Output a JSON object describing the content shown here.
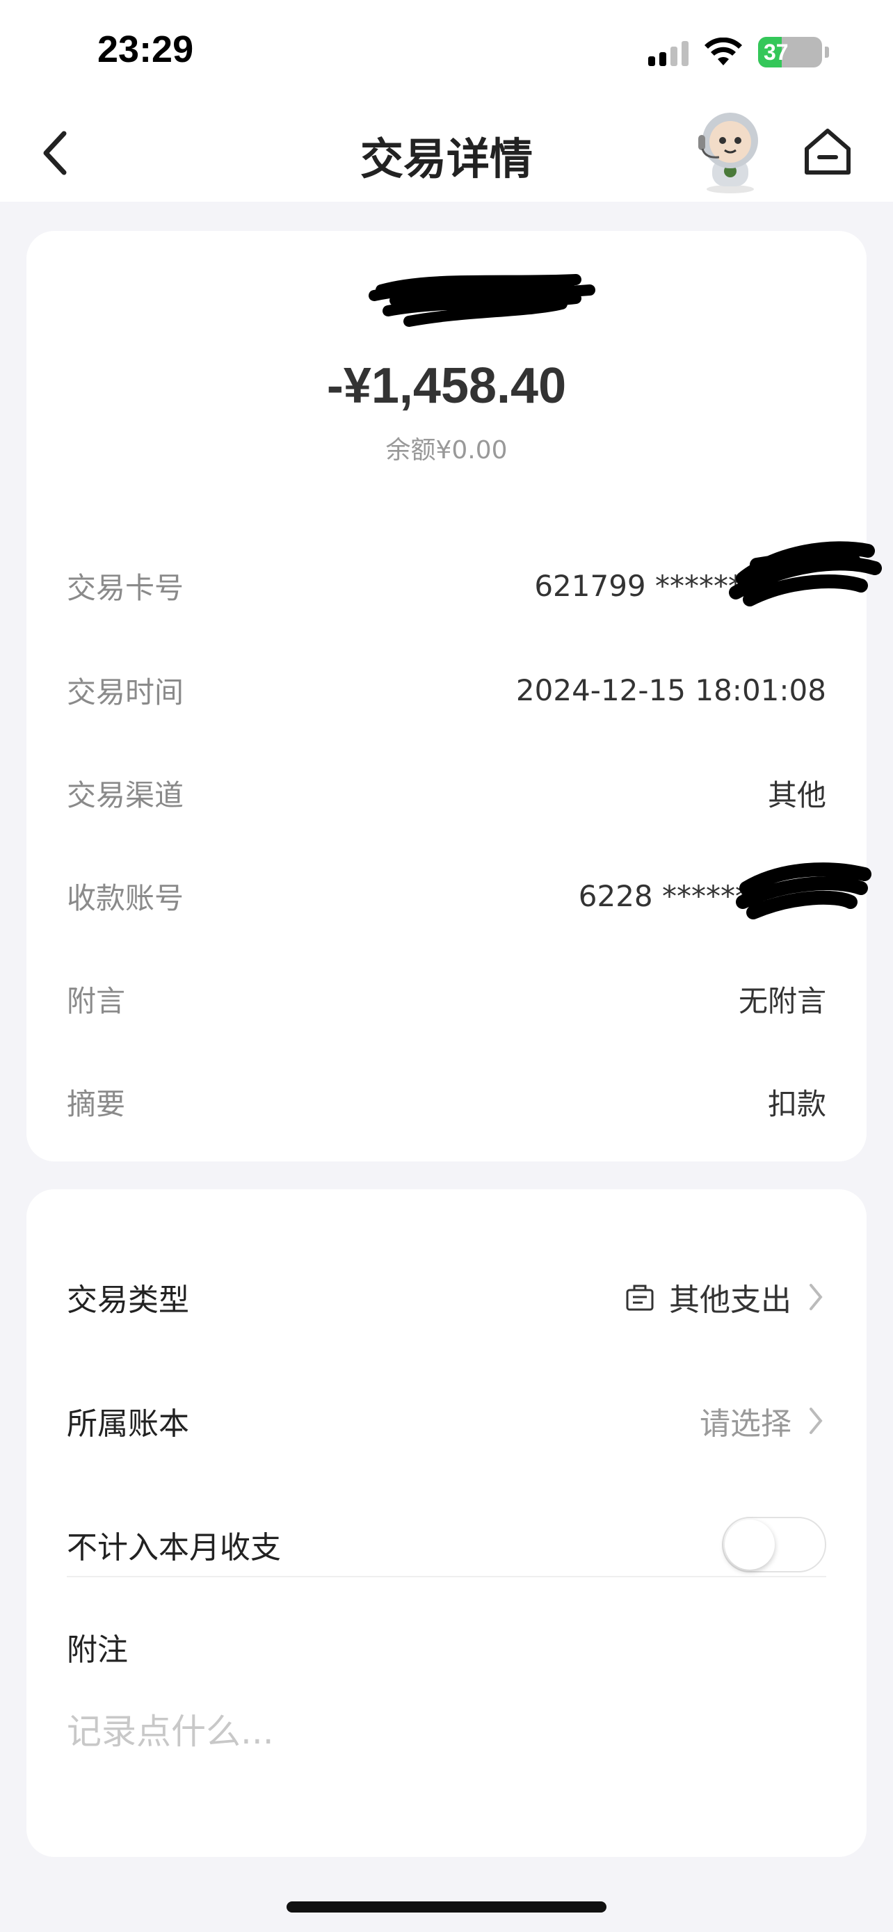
{
  "status_bar": {
    "time": "23:29",
    "battery": "37"
  },
  "nav": {
    "title": "交易详情",
    "back_icon": "chevron-left-icon",
    "assistant_icon": "robot-assistant-icon",
    "home_icon": "home-icon"
  },
  "summary": {
    "amount": "-¥1,458.40",
    "balance": "余额¥0.00"
  },
  "details": [
    {
      "label": "交易卡号",
      "value": "621799 ******"
    },
    {
      "label": "交易时间",
      "value": "2024-12-15 18:01:08"
    },
    {
      "label": "交易渠道",
      "value": "其他"
    },
    {
      "label": "收款账号",
      "value": "6228 ******"
    },
    {
      "label": "附言",
      "value": "无附言"
    },
    {
      "label": "摘要",
      "value": "扣款"
    }
  ],
  "settings": {
    "type_label": "交易类型",
    "type_value": "其他支出",
    "type_icon": "category-icon",
    "book_label": "所属账本",
    "book_value": "请选择",
    "exclude_label": "不计入本月收支",
    "exclude_on": false,
    "note_label": "附注",
    "note_placeholder": "记录点什么..."
  },
  "colors": {
    "background": "#f4f4f8",
    "card": "#ffffff",
    "label_gray": "#8a8a8a",
    "battery_green": "#34c759"
  }
}
